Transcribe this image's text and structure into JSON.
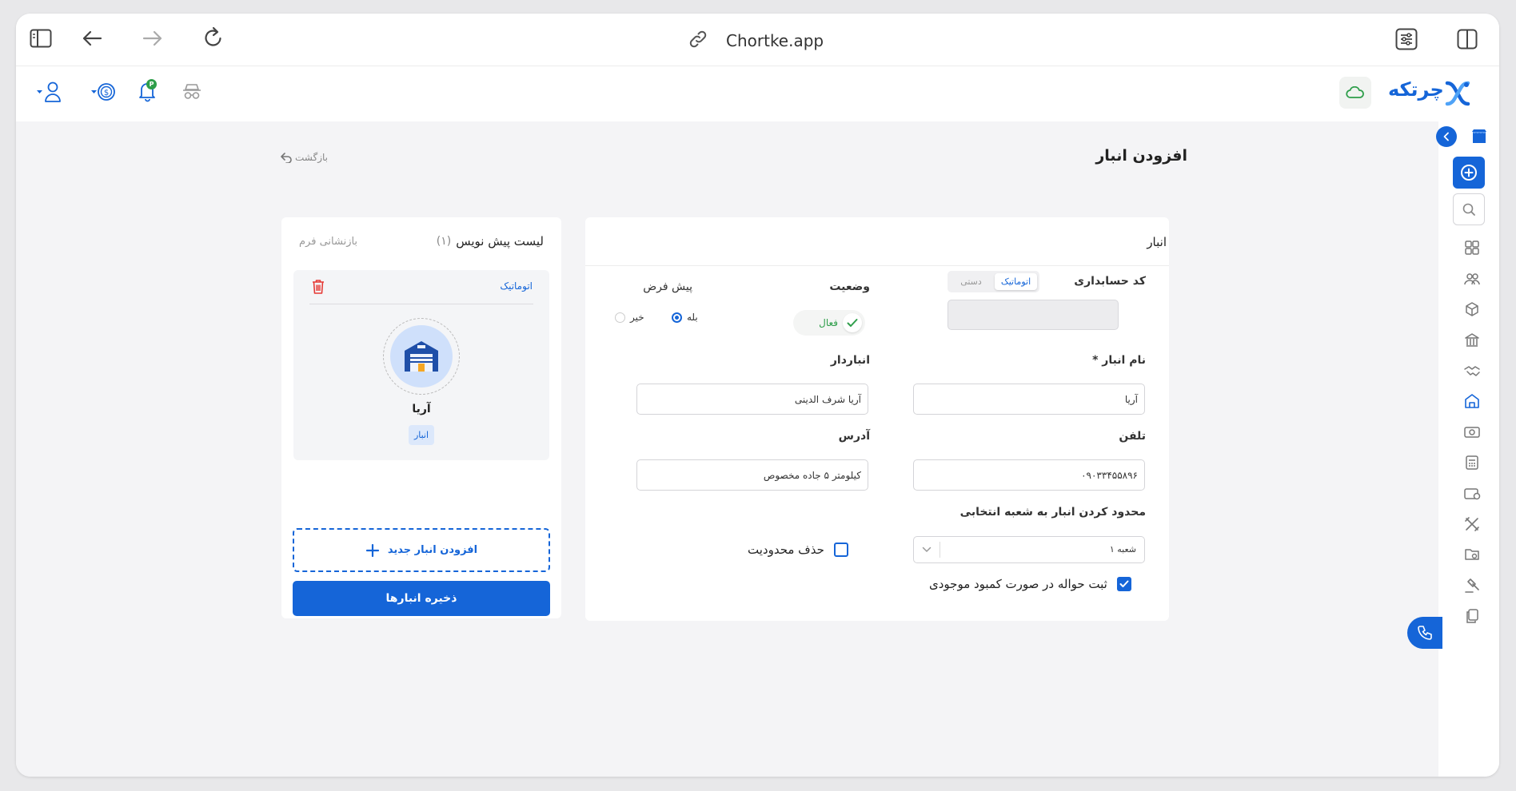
{
  "browser": {
    "url": "Chortke.app",
    "icons": [
      "sidebar-toggle-icon",
      "back-arrow-icon",
      "forward-arrow-icon",
      "reload-icon",
      "link-icon",
      "tune-icon",
      "split-view-icon"
    ]
  },
  "app_header": {
    "logo_text": "چرتکه",
    "notification_badge": "P"
  },
  "page": {
    "title": "افزودن انبار",
    "back_label": "بازگشت"
  },
  "form": {
    "section_title": "انبار",
    "accounting_code": {
      "label": "کد حسابداری",
      "options": [
        "اتوماتیک",
        "دستی"
      ],
      "selected": "اتوماتیک",
      "value": ""
    },
    "status": {
      "label": "وضعیت",
      "value": "فعال"
    },
    "default": {
      "label": "پیش فرض",
      "options": [
        "بله",
        "خیر"
      ],
      "selected": "بله"
    },
    "warehouse_name": {
      "label": "نام انبار *",
      "value": "آریا"
    },
    "warehouse_keeper": {
      "label": "انباردار",
      "value": "آریا شرف الدینی"
    },
    "phone": {
      "label": "تلفن",
      "value": "۰۹۰۳۳۴۵۵۸۹۶"
    },
    "address": {
      "label": "آدرس",
      "value": "کیلومتر ۵ جاده مخصوص"
    },
    "branch_limit": {
      "label": "محدود کردن انبار به شعبه انتخابی",
      "value": "شعبه ۱"
    },
    "remove_limit": {
      "label": "حذف محدودیت",
      "checked": false
    },
    "register_on_shortage": {
      "label": "ثبت حواله در صورت کمبود موجودی",
      "checked": true
    }
  },
  "draft_list": {
    "title": "لیست پیش نویس",
    "count": "(۱)",
    "reset_label": "بازنشانی فرم",
    "item": {
      "code_mode": "اتوماتیک",
      "name": "آریا",
      "tag": "انبار"
    },
    "add_new_label": "افزودن انبار جدید",
    "save_label": "ذخیره انبارها"
  },
  "colors": {
    "primary": "#1565d8",
    "success": "#2e9e4a",
    "danger": "#e53935",
    "background": "#f4f4f6"
  }
}
